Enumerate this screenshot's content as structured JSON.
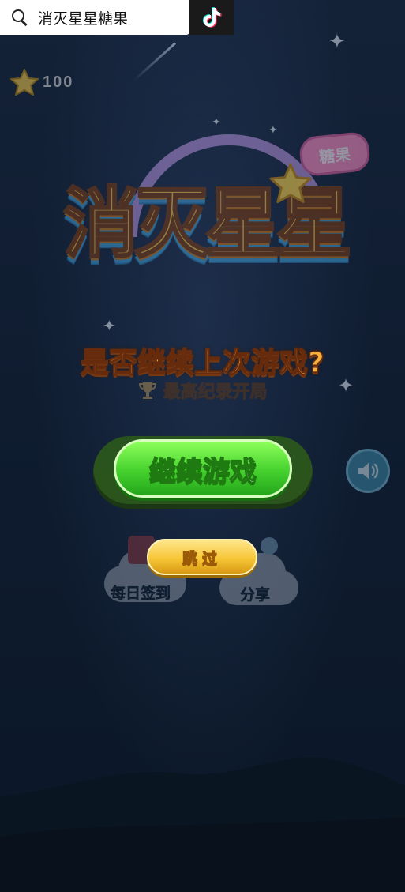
{
  "search": {
    "query": "消灭星星糖果"
  },
  "header": {
    "score": "100"
  },
  "logo": {
    "title": "消灭星星",
    "badge": "糖果"
  },
  "dialog": {
    "question": "是否继续上次游戏?",
    "record_label": "最高纪录开局",
    "continue_label": "继续游戏",
    "skip_label": "跳过"
  },
  "background_menu": {
    "daily_checkin": "每日签到",
    "share": "分享"
  },
  "colors": {
    "background": "#0d1a2c",
    "continue_green": "#45d12e",
    "skip_yellow": "#f7c637",
    "question_orange": "#ffb740"
  },
  "icons": [
    "search-icon",
    "tiktok-icon",
    "star-icon",
    "trophy-icon",
    "speaker-icon"
  ]
}
